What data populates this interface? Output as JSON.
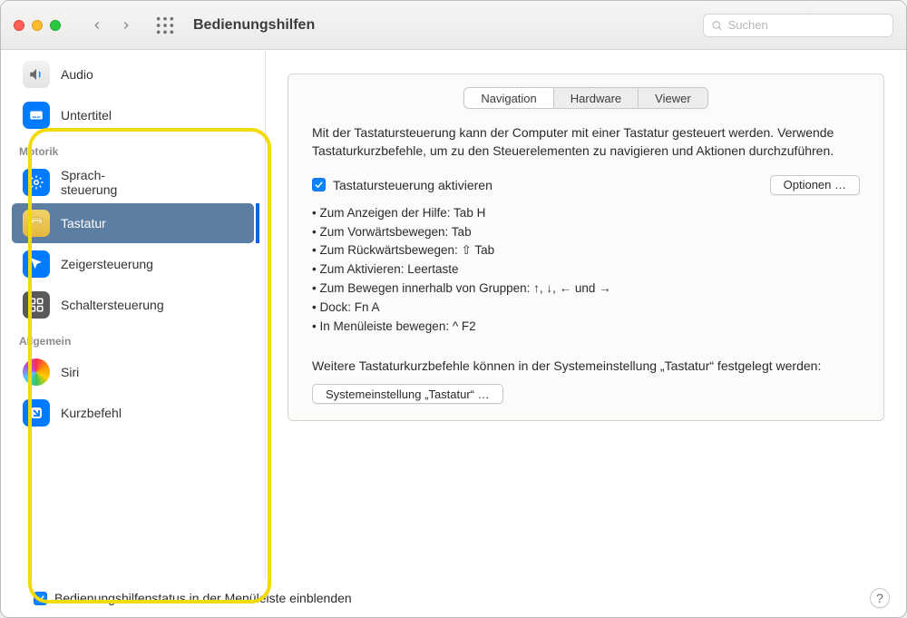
{
  "window": {
    "title": "Bedienungshilfen"
  },
  "search": {
    "placeholder": "Suchen"
  },
  "sidebar": {
    "top": [
      {
        "label": "Audio"
      },
      {
        "label": "Untertitel"
      }
    ],
    "section_motor": "Motorik",
    "motor": [
      {
        "label": "Sprach-\nsteuerung"
      },
      {
        "label": "Tastatur"
      },
      {
        "label": "Zeigersteuerung"
      },
      {
        "label": "Schaltersteuerung"
      }
    ],
    "section_general": "Allgemein",
    "general": [
      {
        "label": "Siri"
      },
      {
        "label": "Kurzbefehl"
      }
    ]
  },
  "tabs": {
    "navigation": "Navigation",
    "hardware": "Hardware",
    "viewer": "Viewer"
  },
  "main": {
    "description": "Mit der Tastatursteuerung kann der Computer mit einer Tastatur gesteuert werden. Verwende Tastaturkurzbefehle, um zu den Steuerelementen zu navigieren und Aktionen durchzuführen.",
    "enable_label": "Tastatursteuerung aktivieren",
    "options_button": "Optionen …",
    "bullets": [
      "Zum Anzeigen der Hilfe: Tab H",
      "Zum Vorwärtsbewegen: Tab",
      "Zum Rückwärtsbewegen: ⇧ Tab",
      "Zum Aktivieren: Leertaste",
      "Zum Bewegen innerhalb von Gruppen: ↑, ↓, ← und →",
      "Dock: Fn A",
      "In Menüleiste bewegen: ^ F2"
    ],
    "more": "Weitere Tastaturkurzbefehle können in der Systemeinstellung „Tastatur“ festgelegt werden:",
    "open_button": "Systemeinstellung „Tastatur“ …"
  },
  "bottom": {
    "status_label": "Bedienungshilfenstatus in der Menüleiste einblenden"
  }
}
